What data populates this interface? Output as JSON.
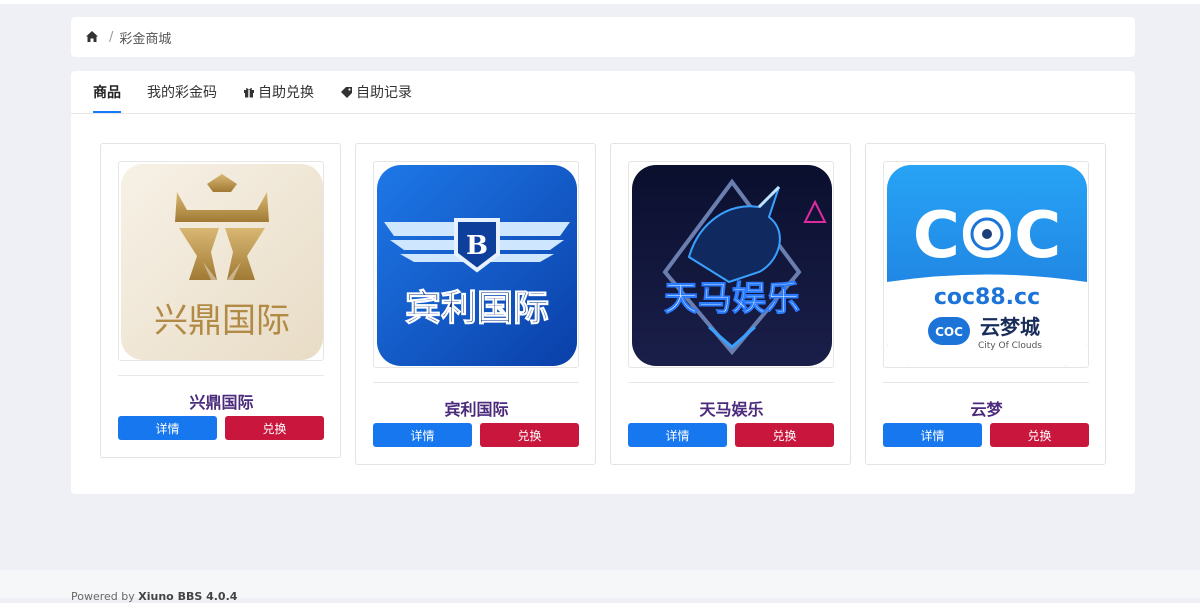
{
  "breadcrumb": {
    "separator": "/",
    "current": "彩金商城"
  },
  "tabs": [
    {
      "label": "商品",
      "icon": "none"
    },
    {
      "label": "我的彩金码",
      "icon": "none"
    },
    {
      "label": "自助兑换",
      "icon": "gift-icon"
    },
    {
      "label": "自助记录",
      "icon": "tag-icon"
    }
  ],
  "products": [
    {
      "name": "兴鼎国际",
      "logo_text": "兴鼎国际",
      "detail_label": "详情",
      "buy_label": "兑换"
    },
    {
      "name": "宾利国际",
      "logo_text": "宾利国际",
      "logo_badge": "B",
      "detail_label": "详情",
      "buy_label": "兑换"
    },
    {
      "name": "天马娱乐",
      "logo_text": "天马娱乐",
      "detail_label": "详情",
      "buy_label": "兑换"
    },
    {
      "name": "云梦",
      "logo_text_top": "COC",
      "logo_domain": "coc88.cc",
      "logo_badge": "COC",
      "logo_brand": "云梦城",
      "logo_sub": "City Of Clouds",
      "detail_label": "详情",
      "buy_label": "兑换"
    }
  ],
  "footer": {
    "prefix": "Powered by",
    "brand": "Xiuno BBS 4.0.4"
  },
  "colors": {
    "accent": "#1677ee",
    "danger": "#c8163c",
    "title": "#4b2a7b"
  }
}
